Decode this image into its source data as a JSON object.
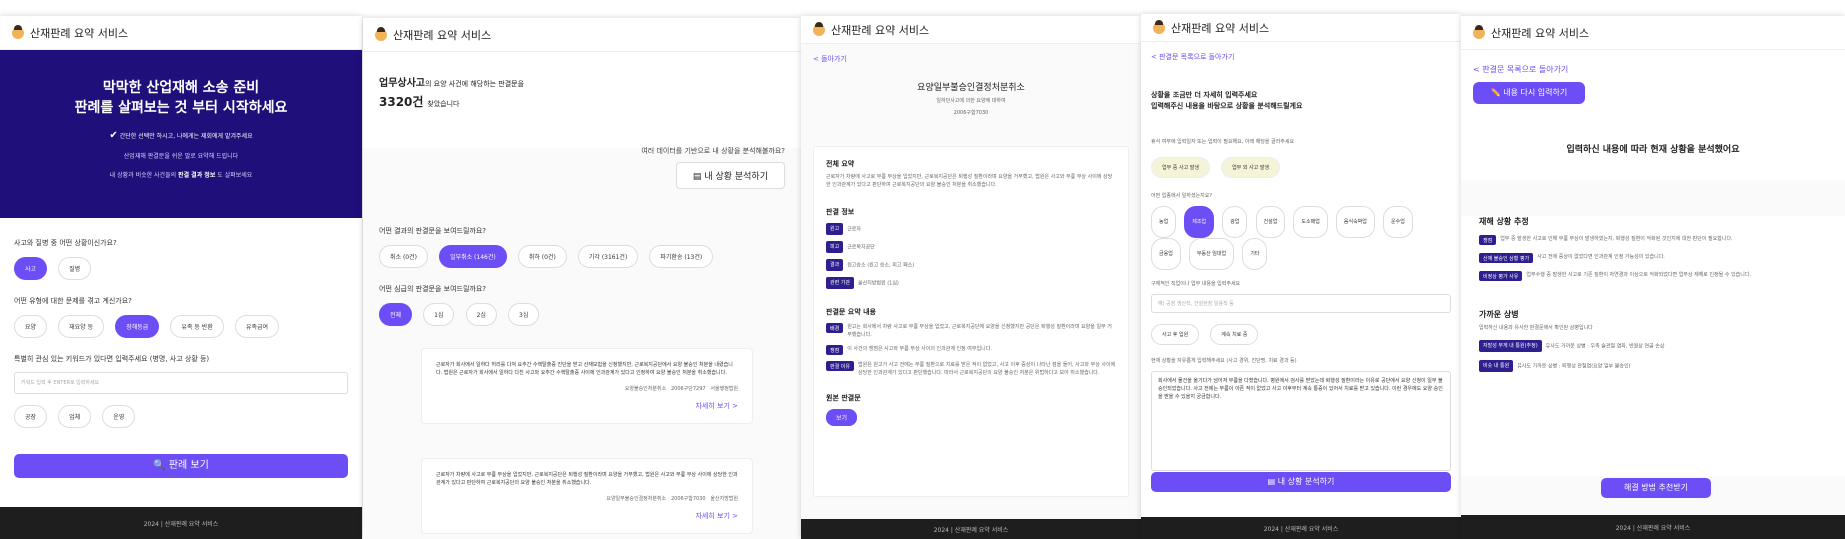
{
  "app": {
    "title": "산재판례 요약 서비스",
    "footer": "2024 | 산재판례 요약 서비스",
    "accent": "#6c4df6",
    "hero_bg": "#1f0f7a"
  },
  "screen1": {
    "hero_line1": "막막한 산업재해 소송 준비",
    "hero_line2": "판례를 살펴보는 것 부터 시작하세요",
    "check_text": "간단한 선택만 하시고, 나에게는 제회에게 맡겨주세요",
    "sub1": "산업재해 판결문을 쉬운 말로 요약해 드립니다",
    "sub2_pre": "내 상황과 비슷한 사건들의",
    "sub2_bold": "판결 결과 정보",
    "sub2_post": "도 살펴보세요",
    "q1": "사고와 질병 중 어떤 상황이신가요?",
    "q1_options": [
      "사고",
      "질병"
    ],
    "q2": "어떤 유형에 대한 문제를 겪고 계신가요?",
    "q2_options": [
      "요양",
      "재요양 등",
      "장해등급",
      "유족 등 반환",
      "유족급여"
    ],
    "q3": "특별히 관심 있는 키워드가 있다면 입력주세요 (병명, 사고 상황 등)",
    "input_placeholder": "키워드 입력 후 ENTER로 입력하세요",
    "keywords": [
      "공장",
      "업체",
      "운영"
    ],
    "submit": "판례 보기"
  },
  "screen2": {
    "line1_bold": "업무상사고",
    "line1_rest": "의 요양 사건에 해당하는 판결문을",
    "count": "3320건",
    "count_rest": "찾았습니다",
    "analyze_prompt": "여러 데이터를 기반으로 내 상황을 분석해볼까요?",
    "analyze_button": "내 상황 분석하기",
    "q_result": "어떤 결과의 판결문을 보여드릴까요?",
    "result_options": [
      "취소 (0건)",
      "일부취소 (146건)",
      "취하 (0건)",
      "기각 (3161건)",
      "파기환송 (13건)"
    ],
    "q_instance": "어떤 심급의 판결문을 보여드릴까요?",
    "instance_options": [
      "전체",
      "1심",
      "2심",
      "3심"
    ],
    "cards": [
      {
        "text": "근로자가 회사에서 일하다 허리를 다쳐 요추간 수핵탈출증 진단을 받고 산재보험을 신청했지만, 근로복지공단에서 요양 불승인 처분을 내렸습니다. 법원은 근로자가 회사에서 일하다 다친 사고와 요추간 수핵탈출증 사이에 인과관계가 있다고 인정하여 요양 불승인 처분을 취소했습니다.",
        "meta1": "요양불승인처분취소",
        "meta2": "2006구단7297",
        "meta3": "서울행정법원",
        "link": "자세히 보기 >"
      },
      {
        "text": "근로자가 차량에 사고로 무릎 부상을 입었지만, 근로복지공단은 퇴행성 질환이라며 요양을 거부했고, 법원은 사고와 무릎 부상 사이에 상당한 인과관계가 있다고 판단하여 근로복지공단의 요양 불승인 처분을 취소했습니다.",
        "meta1": "요양일부불승인결정처분취소",
        "meta2": "2006구합7030",
        "meta3": "울산지방법원",
        "link": "자세히 보기 >"
      }
    ]
  },
  "screen3": {
    "back": "< 돌아가기",
    "title": "요양일부불승인결정처분취소",
    "subtitle": "일하던사고에 의한 요양에 대하여",
    "date": "2006구합7030",
    "summary_title": "전체 요약",
    "summary_text": "근로자가 차량에 사고로 무릎 부상을 입었지만, 근로복지공단은 퇴행성 질환이라며 요양을 거부했고, 법원은 사고와 무릎 부상 사이에 상당한 인과관계가 있다고 판단하여 근로복지공단의 요양 불승인 처분을 취소했습니다.",
    "info_title": "판결 정보",
    "info": [
      {
        "tag": "원고",
        "value": "근로자"
      },
      {
        "tag": "피고",
        "value": "근로복지공단"
      },
      {
        "tag": "결과",
        "value": "원고승소 (원고 승소, 피고 패소)"
      },
      {
        "tag": "관련 기관",
        "value": "울산지방법원 (1심)"
      }
    ],
    "content_title": "판결문 요약 내용",
    "content": [
      {
        "tag": "배경",
        "value": "원고는 회사에서 차량 사고로 무릎 부상을 입었고, 근로복지공단에 요양을 신청했지만 공단은 퇴행성 질환이라며 요양을 일부 거부했습니다."
      },
      {
        "tag": "쟁점",
        "value": "이 사건의 쟁점은 사고와 무릎 부상 사이의 인과관계 인정 여부입니다."
      },
      {
        "tag": "판결 이유",
        "value": "법원은 원고가 사고 전에는 무릎 질환으로 치료를 받은 적이 없었고, 사고 이후 증상이 나타난 점을 들어, 사고와 부상 사이에 상당한 인과관계가 있다고 판단했습니다. 따라서 근로복지공단의 요양 불승인 처분은 위법하다고 보아 취소했습니다."
      }
    ],
    "original_title": "원본 판결문",
    "original_button": "보기"
  },
  "screen4": {
    "back": "< 판결문 목록으로 돌아가기",
    "heading1": "상황을 조금만 더 자세히 입력주세요",
    "heading2": "입력해주신 내용을 바탕으로 상황을 분석해드릴게요",
    "q_type": "휴식 여부에 입력일자 또는 입력이 필요해요, 아래 해당을 골라주세요",
    "type_options": [
      "업무 중 사고 발생",
      "업무 외 사고 발생"
    ],
    "q_job": "어떤 업종에서 일하셨는지요?",
    "job_options": [
      "농업",
      "제조업",
      "광업",
      "건설업",
      "도소매업",
      "음식숙박업",
      "운수업",
      "금융업",
      "부동산 임대업",
      "기타"
    ],
    "q_detail": "구체적인 직업이나 업무 내용을 입력주세요",
    "detail_placeholder": "예) 공장 생산직, 건설현장 일용직 등",
    "chip_options": [
      "사고 후 입원",
      "계속 치료 중"
    ],
    "q_situation": "현재 상황을 자유롭게 입력해주세요 (사고 경위, 진단명, 치료 경과 등)",
    "situation_text": "회사에서 물건을 옮기다가 넘어져 무릎을 다쳤습니다. 병원에서 검사를 받았는데 퇴행성 질환이라는 이유로 공단에서 요양 신청이 일부 불승인되었습니다. 사고 전에는 무릎이 아픈 적이 없었고 사고 이후부터 계속 통증이 있어서 치료를 받고 있습니다. 이런 경우에도 요양 승인을 받을 수 있을지 궁금합니다.",
    "analyze": "내 상황 분석하기"
  },
  "screen5": {
    "back": "< 판결문 목록으로 돌아가기",
    "re_input": "내용 다시 입력하기",
    "result_title": "입력하신 내용에 따라 현재 상황을 분석했어요",
    "disaster_title": "재해 상황 추정",
    "disaster": [
      {
        "tag": "쟁점",
        "value": "업무 중 발생한 사고로 인해 무릎 부상이 발생하였는지, 퇴행성 질환이 악화된 것인지에 대한 판단이 필요합니다."
      },
      {
        "tag": "산재 불승인 상황 평가",
        "value": "사고 전에 증상이 없었다면 인과관계 인정 가능성이 있습니다."
      },
      {
        "tag": "비정상 평가 사유",
        "value": "업무수행 중 발생한 사고로 기존 질환이 자연경과 이상으로 악화되었다면 업무상 재해로 인정될 수 있습니다."
      }
    ],
    "possible_title": "가까운 상병",
    "possible_desc": "입력하신 내용과 유사한 판결문에서 확인된 상병입니다",
    "possible": [
      {
        "tag": "자발성 무게 내 통원(추정)",
        "value": "유사도 가까운 상병 : 우측 슬관절 염좌, 반월상 연골 손상"
      },
      {
        "tag": "비슷 내 통원",
        "value": "유사도 가까운 상병 : 퇴행성 관절염(요양 일부 불승인)"
      }
    ],
    "solution": "해결 방법 추천받기"
  }
}
